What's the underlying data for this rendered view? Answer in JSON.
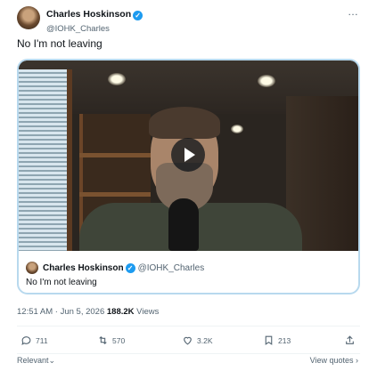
{
  "post": {
    "author_name": "Charles Hoskinson",
    "author_handle": "@IOHK_Charles",
    "verified_icon": "verified-badge-icon",
    "more_icon": "…",
    "text": "No I'm not leaving"
  },
  "quoted_post": {
    "author_name": "Charles Hoskinson",
    "author_handle": "@IOHK_Charles",
    "text": "No I'm not leaving",
    "media": "video",
    "play_icon": "play-icon"
  },
  "meta": {
    "time": "12:51 AM",
    "separator": " · ",
    "date": "Jun 5, 2026",
    "views_count": "188.2K",
    "views_label": "Views"
  },
  "actions": {
    "replies": "711",
    "reposts": "570",
    "likes": "3.2K",
    "bookmarks": "213"
  },
  "footer": {
    "sort_label": "Relevant",
    "view_quotes_label": "View quotes"
  },
  "colors": {
    "accent": "#1d9bf0",
    "text_primary": "#0f1419",
    "text_secondary": "#536471",
    "quote_border": "#b8d9ee"
  }
}
